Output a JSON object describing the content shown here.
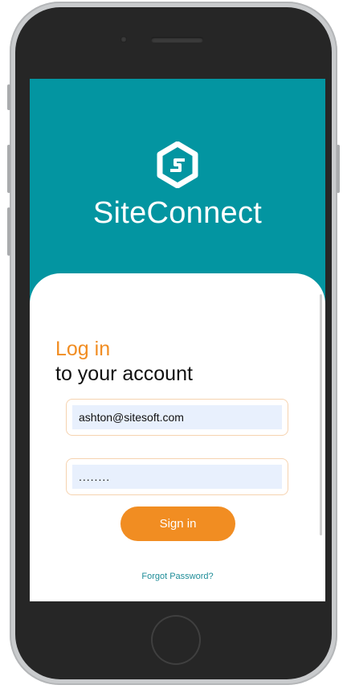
{
  "app": {
    "title": "SiteConnect",
    "logo_icon": "siteconnect-logo-icon"
  },
  "login": {
    "heading_accent": "Log in",
    "heading_main": "to your account",
    "email_value": "ashton@sitesoft.com",
    "password_value": "........",
    "signin_label": "Sign in",
    "forgot_label": "Forgot Password?"
  },
  "colors": {
    "brand_teal": "#0395a1",
    "accent_orange": "#f18d22",
    "link_teal": "#1f8d98",
    "input_fill": "#e8f0fd"
  }
}
